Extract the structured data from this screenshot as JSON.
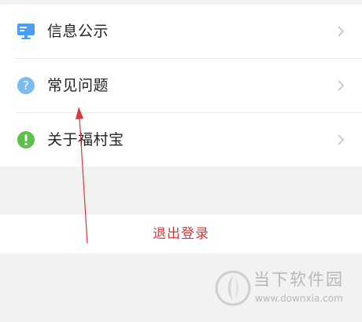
{
  "menu": {
    "items": [
      {
        "label": "信息公示",
        "icon": "monitor-icon",
        "icon_color": "#4a9ff5"
      },
      {
        "label": "常见问题",
        "icon": "question-circle-icon",
        "icon_color": "#7cbcf0"
      },
      {
        "label": "关于福村宝",
        "icon": "exclamation-circle-icon",
        "icon_color": "#5cc14a"
      }
    ]
  },
  "logout": {
    "label": "退出登录",
    "color": "#d9363e"
  },
  "annotation": {
    "arrow_color": "#d9363e"
  },
  "watermark": {
    "name": "当下软件园",
    "url": "www.downxia.com",
    "logo": "downxia-logo"
  }
}
